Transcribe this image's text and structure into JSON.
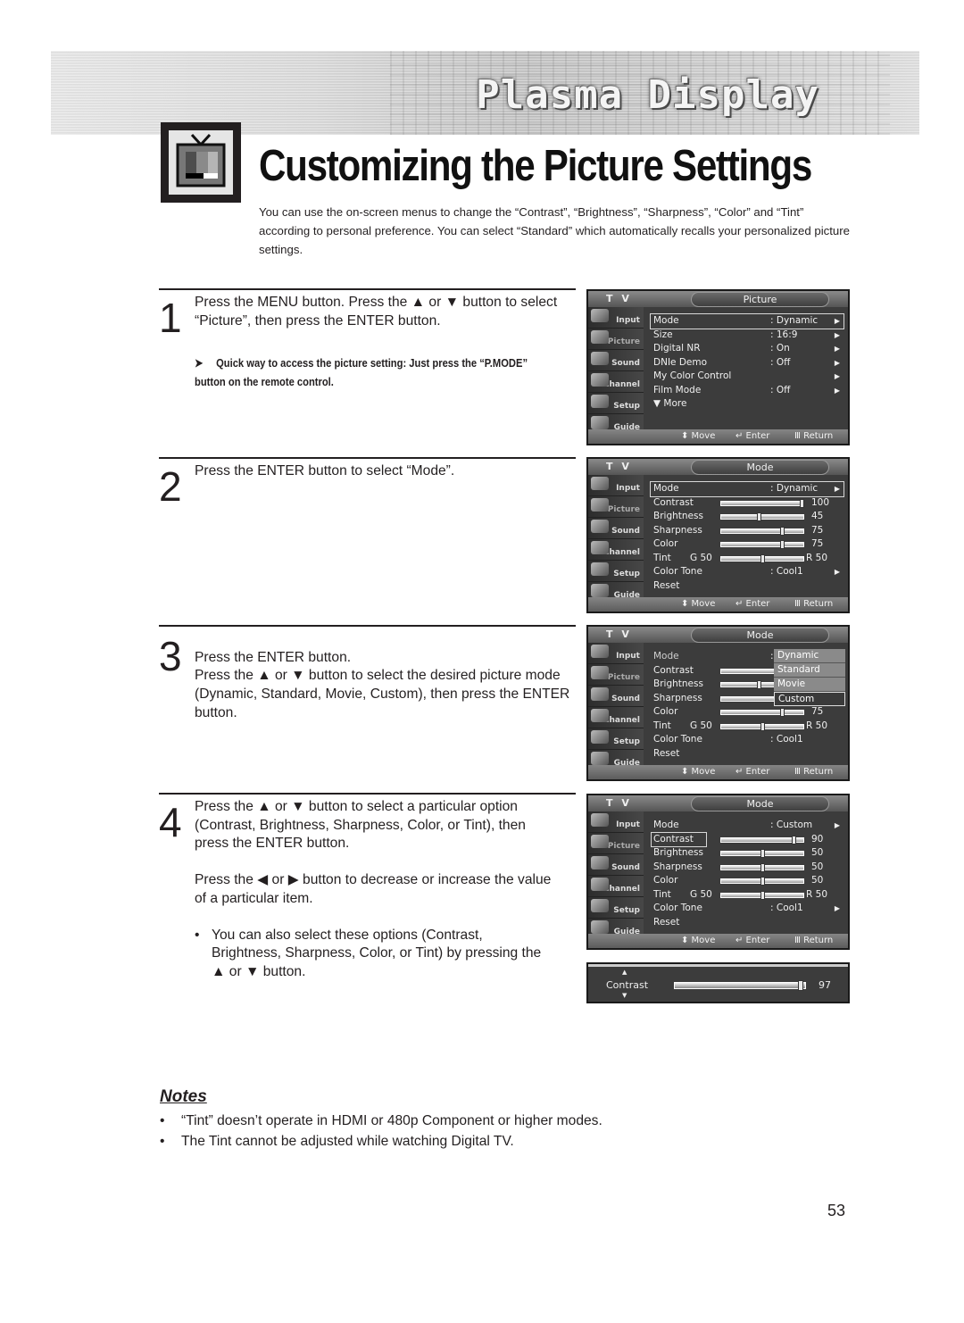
{
  "header": {
    "product": "Plasma Display",
    "title": "Customizing the Picture Settings",
    "intro": "You can use the on-screen menus to change the “Contrast”, “Brightness”, “Sharpness”, “Color” and “Tint” according to personal preference. You can select “Standard” which automatically recalls your personalized picture settings."
  },
  "steps": [
    {
      "number": "1",
      "paragraphs": [
        "Press the MENU button. Press the ▲ or ▼ button to select “Picture”, then press the ENTER button."
      ],
      "tip": "Quick way to access the picture setting: Just press the “P.MODE” button on the remote control.",
      "tip_icon": "arrow-right-icon"
    },
    {
      "number": "2",
      "paragraphs": [
        "Press the ENTER button to select “Mode”."
      ]
    },
    {
      "number": "3",
      "paragraphs": [
        "Press the ENTER button.\nPress the ▲ or ▼ button to select the desired picture mode (Dynamic, Standard, Movie, Custom), then press the ENTER button."
      ]
    },
    {
      "number": "4",
      "paragraphs": [
        "Press the ▲ or ▼ button to select a particular option (Contrast, Brightness, Sharpness, Color, or Tint), then press the ENTER button.",
        "Press the ◀ or ▶ button to decrease or increase the value of a particular item."
      ],
      "bullet": "You can also select these options (Contrast, Brightness, Sharpness, Color, or Tint) by pressing the ▲ or ▼ button."
    }
  ],
  "osd_common": {
    "tv_label": "T V",
    "sidebar": [
      "Input",
      "Picture",
      "Sound",
      "Channel",
      "Setup",
      "Guide"
    ],
    "bottom": {
      "move": "⬍ Move",
      "enter": "↵ Enter",
      "return": "Ⅲ Return"
    },
    "arrow": "▶"
  },
  "osd_screens": [
    {
      "title": "Picture",
      "rows": [
        {
          "label": "Mode",
          "value": ": Dynamic",
          "arrow": true,
          "highlighted": true
        },
        {
          "label": "Size",
          "value": ": 16:9",
          "arrow": true
        },
        {
          "label": "Digital NR",
          "value": ": On",
          "arrow": true
        },
        {
          "label": "DNIe Demo",
          "value": ": Off",
          "arrow": true
        },
        {
          "label": "My Color Control",
          "value": "",
          "arrow": true
        },
        {
          "label": "Film Mode",
          "value": ": Off",
          "arrow": true
        },
        {
          "label": "▼ More",
          "value": "",
          "arrow": false
        }
      ]
    },
    {
      "title": "Mode",
      "rows": [
        {
          "label": "Mode",
          "value": ": Dynamic",
          "arrow": true,
          "highlighted": true
        },
        {
          "label": "Contrast",
          "slider": 100,
          "num": "100"
        },
        {
          "label": "Brightness",
          "slider": 45,
          "num": "45"
        },
        {
          "label": "Sharpness",
          "slider": 75,
          "num": "75"
        },
        {
          "label": "Color",
          "slider": 75,
          "num": "75"
        },
        {
          "label": "Tint",
          "g": "G 50",
          "slider": 50,
          "num": "R 50"
        },
        {
          "label": "Color Tone",
          "value": ": Cool1",
          "arrow": true
        },
        {
          "label": "Reset",
          "value": ""
        }
      ]
    },
    {
      "title": "Mode",
      "rows": [
        {
          "label": "Mode",
          "value": ":",
          "dim": true
        },
        {
          "label": "Contrast",
          "slider": 100,
          "num": ""
        },
        {
          "label": "Brightness",
          "slider": 45,
          "num": ""
        },
        {
          "label": "Sharpness",
          "slider": 75,
          "num": ""
        },
        {
          "label": "Color",
          "slider": 75,
          "num": "75"
        },
        {
          "label": "Tint",
          "g": "G 50",
          "slider": 50,
          "num": "R 50"
        },
        {
          "label": "Color Tone",
          "value": ": Cool1"
        },
        {
          "label": "Reset",
          "value": ""
        }
      ],
      "dropdown": {
        "options": [
          "Dynamic",
          "Standard",
          "Movie",
          "Custom"
        ],
        "selected": "Custom"
      }
    },
    {
      "title": "Mode",
      "rows": [
        {
          "label": "Mode",
          "value": ": Custom",
          "arrow": true
        },
        {
          "label": "Contrast",
          "slider": 90,
          "num": "90",
          "highlighted": true
        },
        {
          "label": "Brightness",
          "slider": 50,
          "num": "50"
        },
        {
          "label": "Sharpness",
          "slider": 50,
          "num": "50"
        },
        {
          "label": "Color",
          "slider": 50,
          "num": "50"
        },
        {
          "label": "Tint",
          "g": "G 50",
          "slider": 50,
          "num": "R 50"
        },
        {
          "label": "Color Tone",
          "value": ": Cool1",
          "arrow": true
        },
        {
          "label": "Reset",
          "value": ""
        }
      ]
    }
  ],
  "osd_adjust": {
    "label": "Contrast",
    "value": 97,
    "value_text": "97",
    "up": "▲",
    "down": "▼"
  },
  "notes": {
    "title": "Notes",
    "items": [
      "“Tint” doesn’t operate in HDMI or 480p Component or higher modes.",
      "The Tint cannot be adjusted while watching Digital TV."
    ]
  },
  "page_number": "53"
}
